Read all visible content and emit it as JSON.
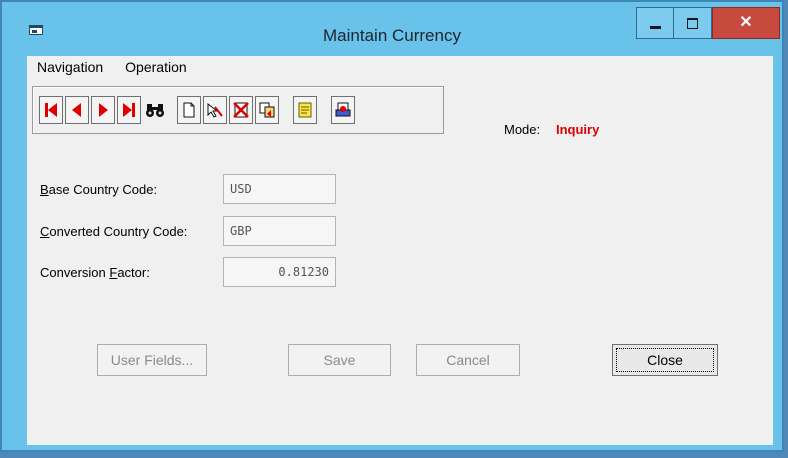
{
  "window": {
    "title": "Maintain Currency"
  },
  "menu": {
    "items": [
      "Navigation",
      "Operation"
    ]
  },
  "toolbar": {
    "buttons": [
      "first-record-icon",
      "previous-record-icon",
      "next-record-icon",
      "last-record-icon",
      "find-binoculars-icon",
      "new-document-icon",
      "edit-pointer-icon",
      "delete-icon",
      "copy-icon",
      "notes-icon",
      "print-icon"
    ]
  },
  "mode": {
    "label": "Mode:",
    "value": "Inquiry",
    "value_color": "#e00000"
  },
  "form": {
    "base_code": {
      "label_u": "B",
      "label_rest": "ase Country Code:",
      "value": "USD"
    },
    "converted_code": {
      "label_u": "C",
      "label_rest": "onverted Country Code:",
      "value": "GBP"
    },
    "factor": {
      "label_pre": "Conversion ",
      "label_u": "F",
      "label_rest": "actor:",
      "value": "0.81230"
    }
  },
  "buttons": {
    "user_fields": "User Fields...",
    "save": "Save",
    "cancel": "Cancel",
    "close": "Close"
  }
}
